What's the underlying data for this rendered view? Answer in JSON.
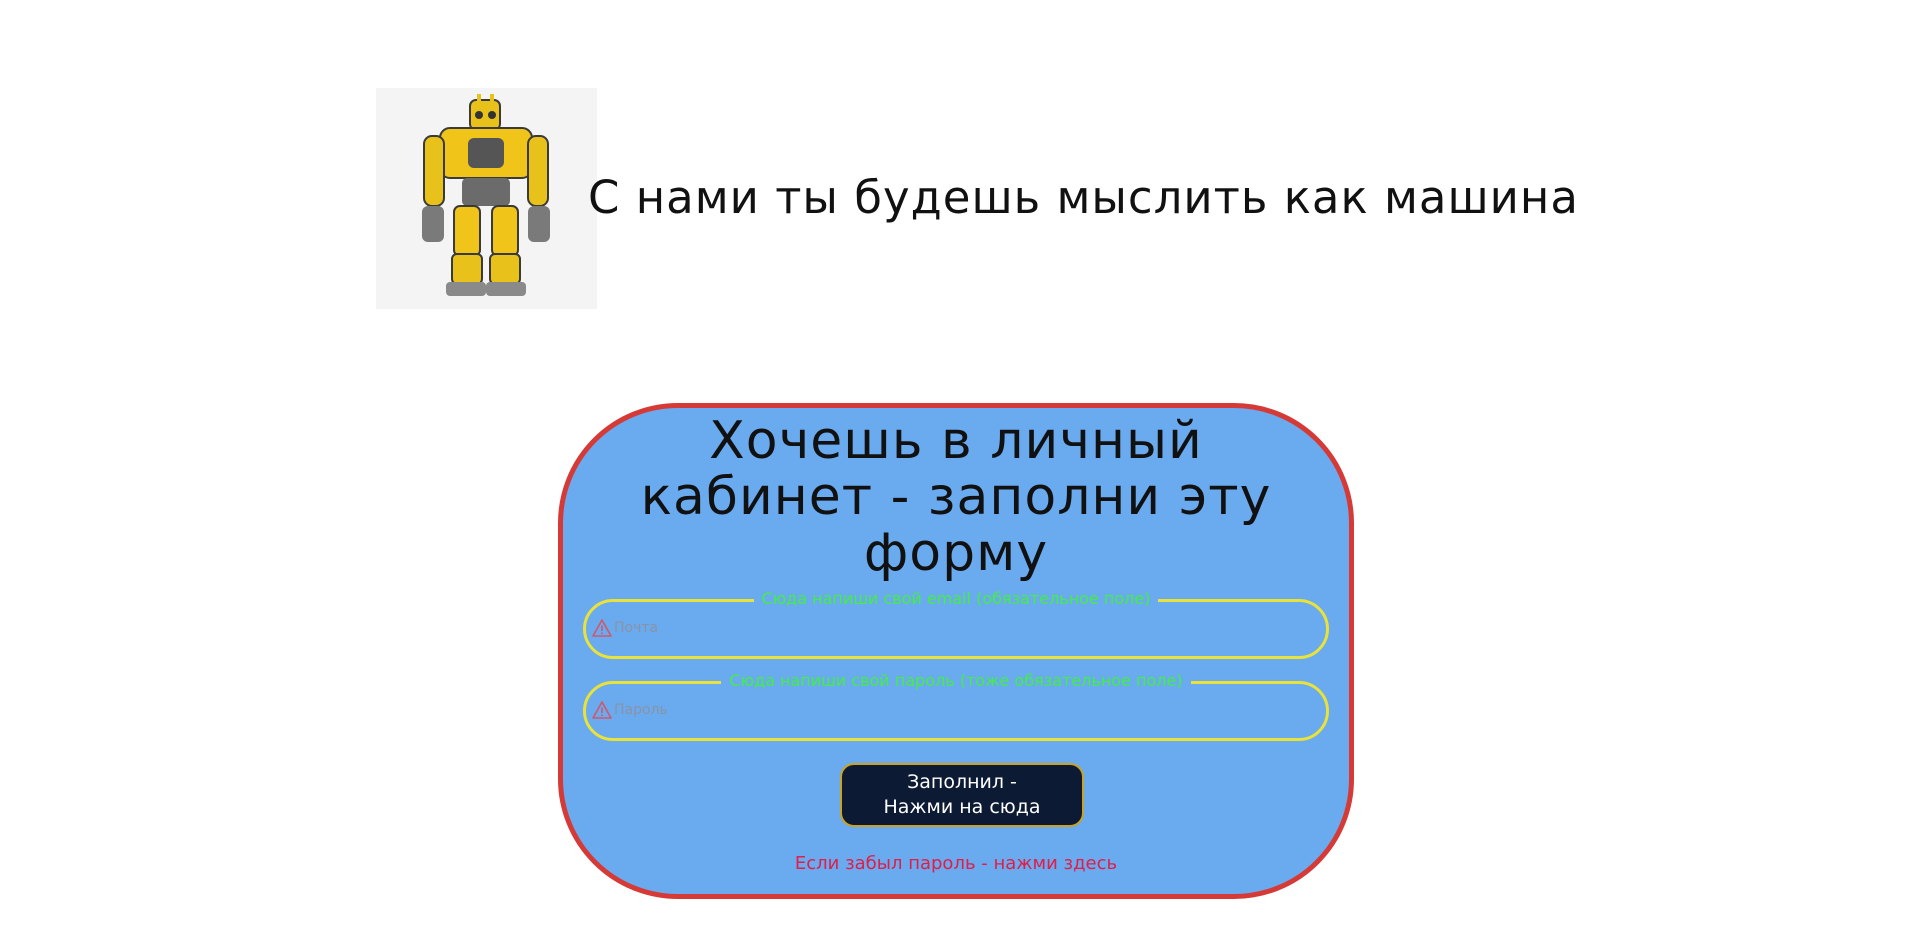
{
  "header": {
    "image": {
      "icon": "yellow-robot-image",
      "background": "#f4f4f4"
    },
    "tagline": "С нами ты будешь мыслить как машина"
  },
  "form": {
    "title": "Хочешь в личный кабинет - заполни эту форму",
    "email_field": {
      "legend": "Сюда напиши свой email (обязательное поле)",
      "placeholder": "Почта",
      "value": "",
      "icon": "warning-icon"
    },
    "password_field": {
      "legend": "Сюда напиши свой пароль (тоже обязательное поле)",
      "placeholder": "Пароль",
      "value": "",
      "icon": "warning-icon"
    },
    "submit_button": {
      "line1": "Заполнил -",
      "line2": "Нажми на сюда"
    },
    "forgot_password_link": "Если забыл пароль - нажми здесь"
  },
  "colors": {
    "card_background": "#6aaaee",
    "card_border": "#d63a36",
    "field_border": "#e8e23a",
    "legend_text": "#44ee44",
    "button_background": "#0c1a33",
    "button_border": "#c9a227",
    "link_text": "#e11d48"
  }
}
